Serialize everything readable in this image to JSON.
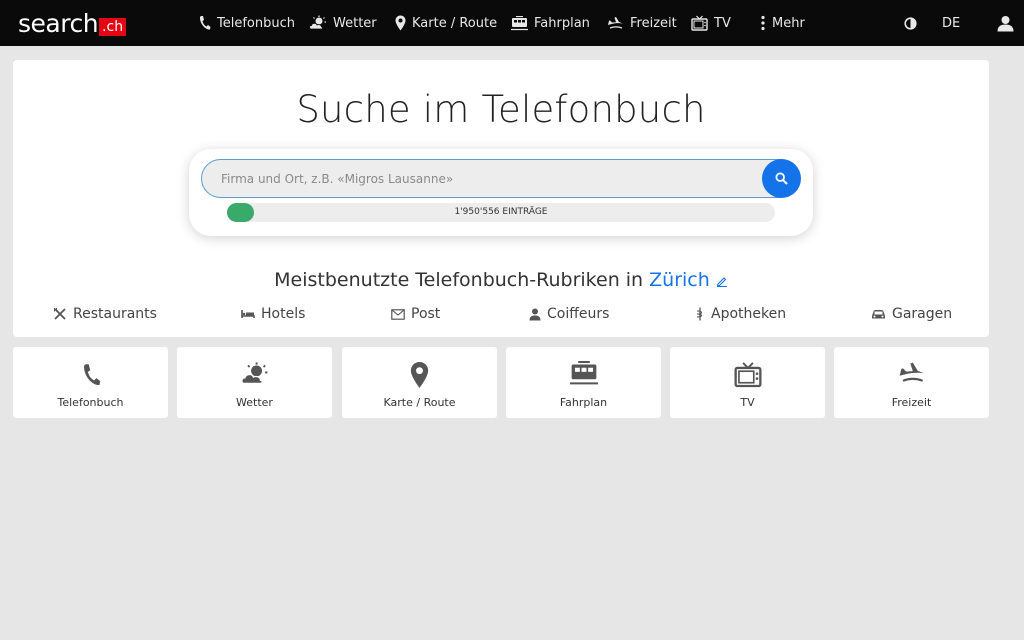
{
  "logo": {
    "word": "search",
    "suffix": ".ch"
  },
  "nav": {
    "telefonbuch": "Telefonbuch",
    "wetter": "Wetter",
    "karte": "Karte / Route",
    "fahrplan": "Fahrplan",
    "freizeit": "Freizeit",
    "tv": "TV",
    "mehr": "Mehr",
    "language": "DE"
  },
  "main": {
    "title": "Suche im Telefonbuch",
    "search": {
      "placeholder": "Firma und Ort, z.B. «Migros Lausanne»",
      "value": ""
    },
    "entries_label": "1'950'556  EINTRÄGE",
    "progress_percent": 5,
    "section_title": "Meistbenutzte Telefonbuch-Rubriken in",
    "city": "Zürich",
    "categories": [
      "Restaurants",
      "Hotels",
      "Post",
      "Coiffeurs",
      "Apotheken",
      "Garagen"
    ]
  },
  "tiles": [
    "Telefonbuch",
    "Wetter",
    "Karte / Route",
    "Fahrplan",
    "TV",
    "Freizeit"
  ],
  "colors": {
    "accent": "#1573ea",
    "brand_red": "#e30613",
    "progress_green": "#3aaa6a",
    "topbar": "#0a0a0a"
  },
  "icons": [
    "phone-icon",
    "weather-icon",
    "map-pin-icon",
    "train-icon",
    "leisure-icon",
    "tv-icon",
    "more-icon",
    "contrast-icon",
    "user-icon",
    "search-icon",
    "edit-icon",
    "restaurant-icon",
    "hotel-icon",
    "post-icon",
    "coiffeur-icon",
    "pharmacy-icon",
    "garage-icon"
  ]
}
